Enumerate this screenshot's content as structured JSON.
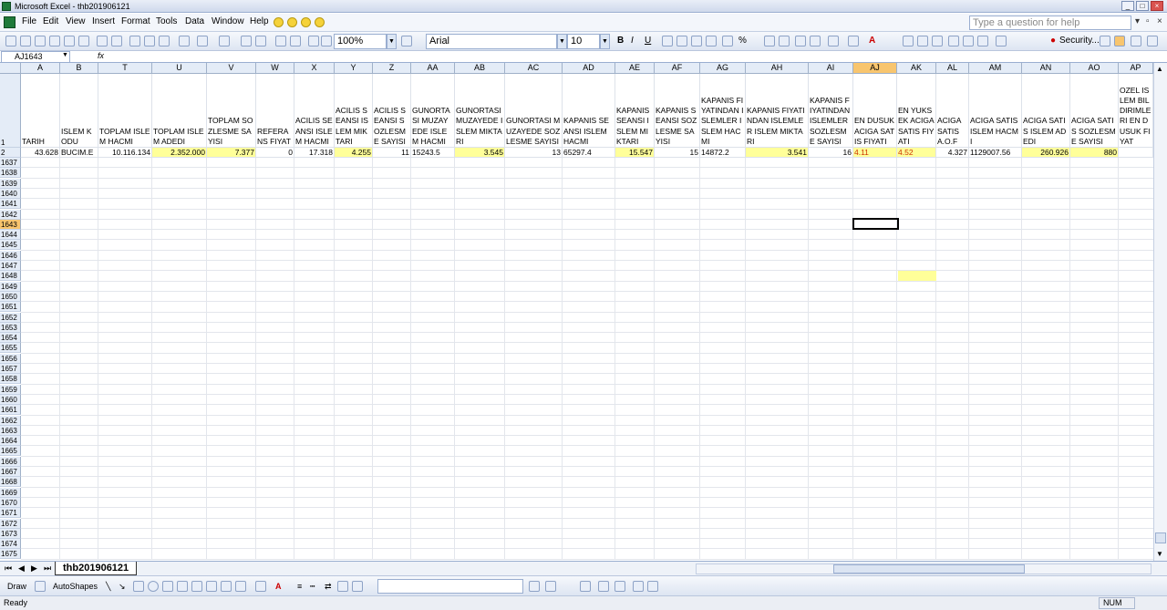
{
  "window": {
    "title": "Microsoft Excel - thb201906121"
  },
  "menu": {
    "items": [
      "File",
      "Edit",
      "View",
      "Insert",
      "Format",
      "Tools",
      "Data",
      "Window",
      "Help"
    ],
    "help_placeholder": "Type a question for help"
  },
  "toolbar": {
    "zoom": "100%",
    "font": "Arial",
    "font_size": "10",
    "security_label": "Security..."
  },
  "formula": {
    "cell_ref": "AJ1643",
    "fx_label": "fx",
    "value": ""
  },
  "columns": [
    "A",
    "B",
    "T",
    "U",
    "V",
    "W",
    "X",
    "Y",
    "Z",
    "AA",
    "AB",
    "AC",
    "AD",
    "AE",
    "AF",
    "AG",
    "AH",
    "AI",
    "AJ",
    "AK",
    "AL",
    "AM",
    "AN",
    "AO",
    "AP"
  ],
  "selected_column": "AJ",
  "header_row_label": "1",
  "data_row_label": "2",
  "header_labels": [
    "TARIH",
    "ISLEM KODU",
    "TOPLAM ISLEM HACMI",
    "TOPLAM ISLEM ADEDI",
    "TOPLAM SOZLESME SAYISI",
    "REFERANS FIYAT",
    "ACILIS SEANSI ISLEM HACMI",
    "ACILIS SEANSI ISLEM MIKTARI",
    "ACILIS SEANSI SOZLESME SAYISI",
    "GUNORTASI MUZAYEDE ISLEM HACMI",
    "GUNORTASI MUZAYEDE ISLEM MIKTARI",
    "GUNORTASI MUZAYEDE SOZLESME SAYISI",
    "KAPANIS SEANSI ISLEM HACMI",
    "KAPANIS SEANSI ISLEM MIKTARI",
    "KAPANIS SEANSI SOZLESME SAYISI",
    "KAPANIS FIYATINDAN ISLEMLER ISLEM HACMI",
    "KAPANIS FIYATINDAN ISLEMLER ISLEM MIKTARI",
    "KAPANIS FIYATINDAN ISLEMLER SOZLESME SAYISI",
    "EN DUSUK ACIGA SATIS FIYATI",
    "EN YUKSEK ACIGA SATIS FIYATI",
    "ACIGA SATIS A.O.F",
    "ACIGA SATIS ISLEM HACMI",
    "ACIGA SATIS ISLEM ADEDI",
    "ACIGA SATIS SOZLESME SAYISI",
    "OZEL ISLEM BILDIRIMLERI EN DUSUK FIYAT"
  ],
  "data_row": [
    "43.628",
    "BUCIM.E",
    "10.116.134",
    "2.352.000",
    "7.377",
    "0",
    "17.318",
    "4.255",
    "11",
    "15243.5",
    "3.545",
    "13",
    "65297.4",
    "15.547",
    "15",
    "14872.2",
    "3.541",
    "16",
    "4.11",
    "4.52",
    "4.327",
    "1129007.56",
    "260.926",
    "880",
    ""
  ],
  "row_numbers": [
    "1637",
    "1638",
    "1639",
    "1640",
    "1641",
    "1642",
    "1643",
    "1644",
    "1645",
    "1646",
    "1647",
    "1648",
    "1649",
    "1650",
    "1651",
    "1652",
    "1653",
    "1654",
    "1655",
    "1656",
    "1657",
    "1658",
    "1659",
    "1660",
    "1661",
    "1662",
    "1663",
    "1664",
    "1665",
    "1666",
    "1667",
    "1668",
    "1669",
    "1670",
    "1671",
    "1672",
    "1673",
    "1674",
    "1675"
  ],
  "selected_row": "1643",
  "sheet_tab": "thb201906121",
  "drawbar": {
    "draw_label": "Draw",
    "autoshapes_label": "AutoShapes"
  },
  "status": {
    "text": "Ready",
    "num": "NUM"
  },
  "colors": {
    "highlight": "#ffff99",
    "selection_header": "#f8c56e",
    "red_text": "#cc3300"
  }
}
